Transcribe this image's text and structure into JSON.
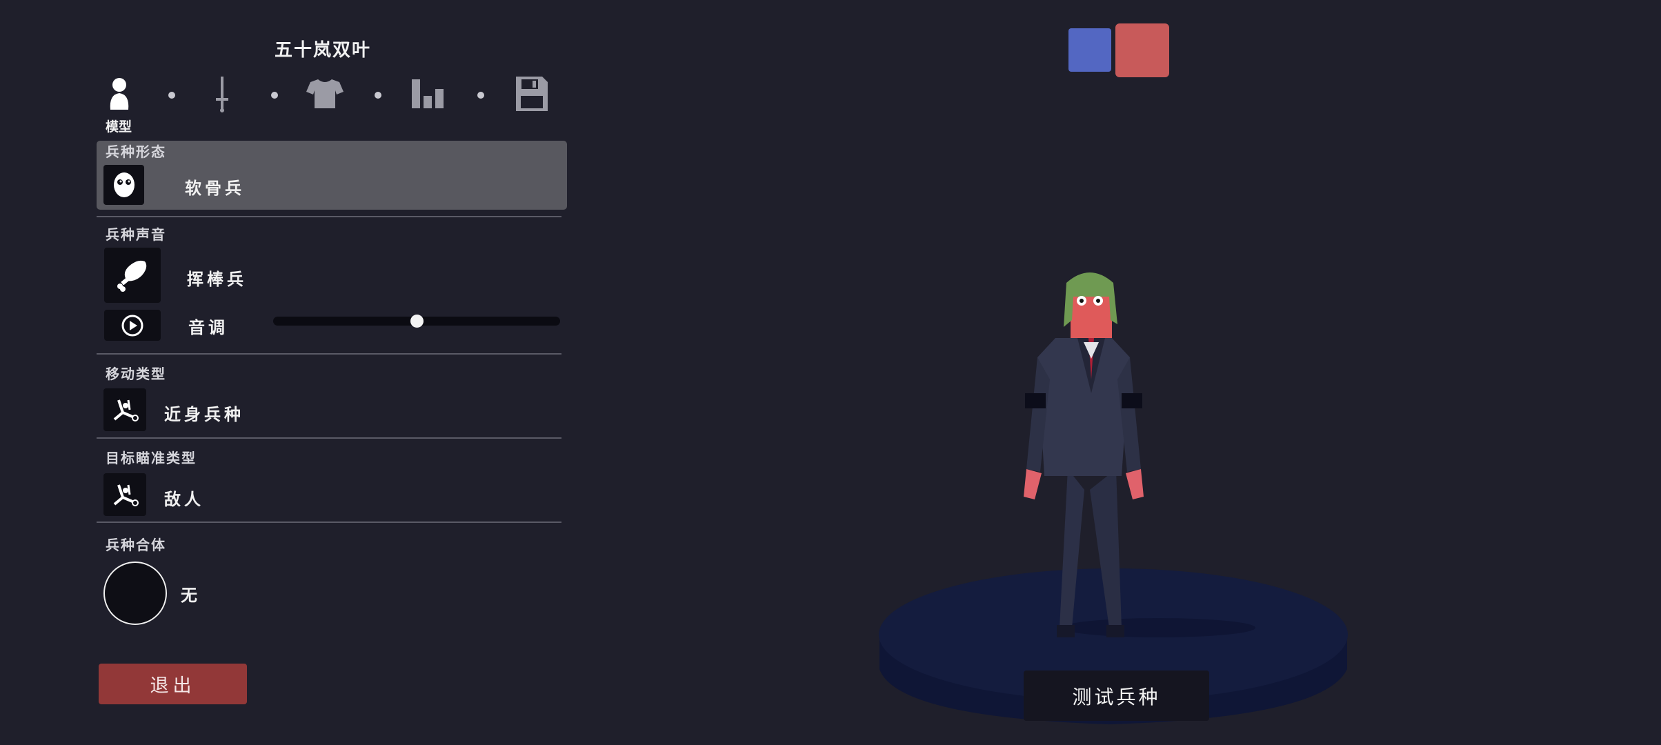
{
  "unit_name": "五十岚双叶",
  "tabs": [
    {
      "icon": "person-icon",
      "label": "模型"
    },
    {
      "icon": "sword-icon"
    },
    {
      "icon": "shirt-icon"
    },
    {
      "icon": "bars-icon"
    },
    {
      "icon": "save-icon"
    }
  ],
  "sections": {
    "form": {
      "label": "兵种形态",
      "value": "软骨兵",
      "icon": "face-icon"
    },
    "voice": {
      "label": "兵种声音",
      "value": "挥棒兵",
      "icon": "chicken-leg-icon",
      "pitch_label": "音调",
      "pitch_value": 0.5,
      "play_icon": "play-icon"
    },
    "movement": {
      "label": "移动类型",
      "value": "近身兵种",
      "icon": "melee-icon"
    },
    "targeting": {
      "label": "目标瞄准类型",
      "value": "敌人",
      "icon": "target-enemy-icon"
    },
    "fusion": {
      "label": "兵种合体",
      "value": "无"
    }
  },
  "buttons": {
    "exit": "退出",
    "test": "测试兵种"
  },
  "colors": {
    "team_blue": "#5367c2",
    "team_red": "#c85a5a",
    "exit_button": "#923838",
    "background": "#1f1f2b"
  }
}
